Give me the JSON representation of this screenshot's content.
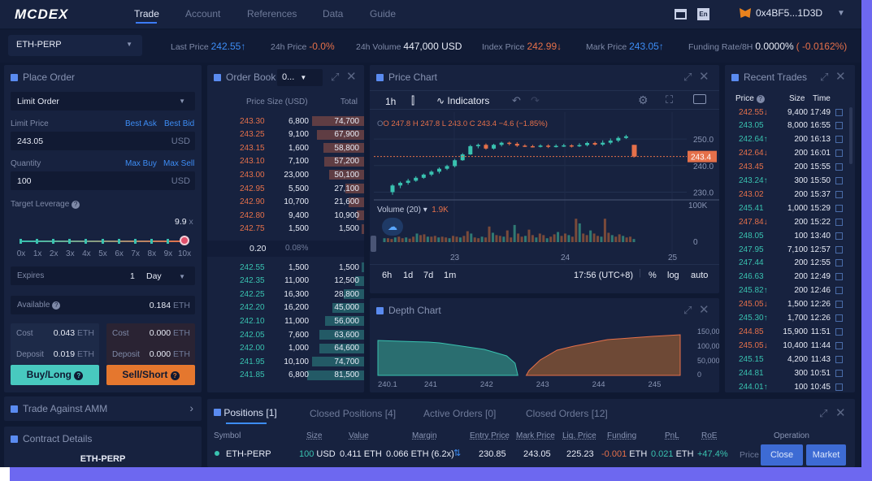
{
  "nav": {
    "logo": "MCDEX",
    "items": [
      "Trade",
      "Account",
      "References",
      "Data",
      "Guide"
    ],
    "wallet": "0x4BF5...1D3D",
    "lang": "En"
  },
  "market": {
    "pair": "ETH-PERP",
    "last_label": "Last Price",
    "last": "242.55↑",
    "h24_label": "24h Price",
    "h24": "-0.0%",
    "vol_label": "24h Volume",
    "vol": "447,000 USD",
    "index_label": "Index Price",
    "index": "242.99↓",
    "mark_label": "Mark Price",
    "mark": "243.05↑",
    "fund_label": "Funding Rate/8H",
    "fund": "0.0000%",
    "fund_alt": "( -0.0162%)"
  },
  "order": {
    "title": "Place Order",
    "type": "Limit Order",
    "lp_label": "Limit Price",
    "best_ask": "Best Ask",
    "best_bid": "Best Bid",
    "lp": "243.05",
    "usd": "USD",
    "qty_label": "Quantity",
    "max_buy": "Max Buy",
    "max_sell": "Max Sell",
    "qty": "100",
    "lev_label": "Target Leverage",
    "lev": "9.9",
    "x": "x",
    "lev_ticks": [
      "0x",
      "1x",
      "2x",
      "3x",
      "4x",
      "5x",
      "6x",
      "7x",
      "8x",
      "9x",
      "10x"
    ],
    "expires_label": "Expires",
    "expires_num": "1",
    "expires_unit": "Day",
    "avail_label": "Available",
    "avail": "0.184",
    "eth": "ETH",
    "cost_label": "Cost",
    "deposit_label": "Deposit",
    "buy_cost": "0.043",
    "buy_dep": "0.019",
    "sell_cost": "0.000",
    "sell_dep": "0.000",
    "buy_btn": "Buy/Long",
    "sell_btn": "Sell/Short",
    "amm": "Trade Against AMM",
    "contract": "Contract Details",
    "contract_sym": "ETH-PERP"
  },
  "book": {
    "title": "Order Book",
    "agg": "0...",
    "h_price": "Price",
    "h_size": "Size (USD)",
    "h_total": "Total",
    "asks": [
      [
        "243.30",
        "6,800",
        "74,700"
      ],
      [
        "243.25",
        "9,100",
        "67,900"
      ],
      [
        "243.15",
        "1,600",
        "58,800"
      ],
      [
        "243.10",
        "7,100",
        "57,200"
      ],
      [
        "243.00",
        "23,000",
        "50,100"
      ],
      [
        "242.95",
        "5,500",
        "27,100"
      ],
      [
        "242.90",
        "10,700",
        "21,600"
      ],
      [
        "242.80",
        "9,400",
        "10,900"
      ],
      [
        "242.75",
        "1,500",
        "1,500"
      ]
    ],
    "spread": "0.20",
    "spread_pct": "0.08%",
    "bids": [
      [
        "242.55",
        "1,500",
        "1,500"
      ],
      [
        "242.35",
        "11,000",
        "12,500"
      ],
      [
        "242.25",
        "16,300",
        "28,800"
      ],
      [
        "242.20",
        "16,200",
        "45,000"
      ],
      [
        "242.10",
        "11,000",
        "56,000"
      ],
      [
        "242.05",
        "7,600",
        "63,600"
      ],
      [
        "242.00",
        "1,000",
        "64,600"
      ],
      [
        "241.95",
        "10,100",
        "74,700"
      ],
      [
        "241.85",
        "6,800",
        "81,500"
      ]
    ]
  },
  "pchart": {
    "title": "Price Chart",
    "interval": "1h",
    "indicators": "Indicators",
    "ohlc_o": "O 247.8",
    "ohlc_h": "H 247.8",
    "ohlc_l": "L 243.0",
    "ohlc_c": "C 243.4",
    "ohlc_chg": "−4.6 (−1.85%)",
    "y": [
      "250.0",
      "240.0",
      "230.0"
    ],
    "cur": "243.4",
    "vol_label": "Volume (20)",
    "vol_val": "1.9K",
    "vol_y": "100K",
    "vol_y0": "0",
    "x": [
      "23",
      "24",
      "25"
    ],
    "ranges": [
      "6h",
      "1d",
      "7d",
      "1m"
    ],
    "time": "17:56 (UTC+8)",
    "pct": "%",
    "log": "log",
    "auto": "auto"
  },
  "depth": {
    "title": "Depth Chart",
    "y": [
      "150,00",
      "100,00",
      "50,000",
      "0"
    ],
    "x": [
      "240.1",
      "241",
      "242",
      "243",
      "244",
      "245"
    ]
  },
  "trades": {
    "title": "Recent Trades",
    "h_price": "Price",
    "h_size": "Size",
    "h_time": "Time",
    "rows": [
      [
        "242.55↓",
        "9,400",
        "17:49",
        "r"
      ],
      [
        "243.05",
        "8,000",
        "16:55",
        "g"
      ],
      [
        "242.64↑",
        "200",
        "16:13",
        "g"
      ],
      [
        "242.64↓",
        "200",
        "16:01",
        "r"
      ],
      [
        "243.45",
        "200",
        "15:55",
        "r"
      ],
      [
        "243.24↑",
        "300",
        "15:50",
        "g"
      ],
      [
        "243.02",
        "200",
        "15:37",
        "r"
      ],
      [
        "245.41",
        "1,000",
        "15:29",
        "g"
      ],
      [
        "247.84↓",
        "200",
        "15:22",
        "r"
      ],
      [
        "248.05",
        "100",
        "13:40",
        "g"
      ],
      [
        "247.95",
        "7,100",
        "12:57",
        "g"
      ],
      [
        "247.44",
        "200",
        "12:55",
        "g"
      ],
      [
        "246.63",
        "200",
        "12:49",
        "g"
      ],
      [
        "245.82↑",
        "200",
        "12:46",
        "g"
      ],
      [
        "245.05↓",
        "1,500",
        "12:26",
        "r"
      ],
      [
        "245.30↑",
        "1,700",
        "12:26",
        "g"
      ],
      [
        "244.85",
        "15,900",
        "11:51",
        "r"
      ],
      [
        "245.05↓",
        "10,400",
        "11:44",
        "r"
      ],
      [
        "245.15",
        "4,200",
        "11:43",
        "g"
      ],
      [
        "244.81",
        "300",
        "10:51",
        "g"
      ],
      [
        "244.01↑",
        "100",
        "10:45",
        "g"
      ]
    ]
  },
  "positions": {
    "tabs": [
      "Positions [1]",
      "Closed Positions [4]",
      "Active Orders [0]",
      "Closed Orders [12]"
    ],
    "cols": [
      "Symbol",
      "Size",
      "Value",
      "Margin",
      "Entry Price",
      "Mark Price",
      "Liq. Price",
      "Funding",
      "PnL",
      "RoE",
      "Operation"
    ],
    "row": {
      "symbol": "ETH-PERP",
      "size": "100",
      "size_unit": "USD",
      "value": "0.411 ETH",
      "margin": "0.066 ETH (6.2x)",
      "entry": "230.85",
      "mark": "243.05",
      "liq": "225.23",
      "funding": "-0.001",
      "funding_unit": "ETH",
      "pnl": "0.021",
      "pnl_unit": "ETH",
      "roe": "+47.4%",
      "op_price": "Price",
      "op_close": "Close",
      "op_market": "Market"
    }
  },
  "colors": {
    "bg": "#0f1932",
    "panel": "#17223f",
    "green": "#39c2b0",
    "red": "#e5704a",
    "blue": "#3d8df5",
    "buy": "#48c9bf",
    "sell": "#e5772e",
    "accent": "#6d68f0"
  },
  "chart_data": [
    {
      "type": "candlestick",
      "title": "",
      "y_axis": [
        "250.0",
        "240.0",
        "230.0"
      ],
      "x_ticks": [
        "23",
        "24",
        "25"
      ],
      "ylim": [
        228,
        254
      ],
      "last": 243.4,
      "candles": [
        [
          230,
          232.5,
          229,
          233
        ],
        [
          232.5,
          233.5,
          231.5,
          234
        ],
        [
          233.5,
          234.3,
          232.8,
          235
        ],
        [
          234.3,
          235.4,
          233.9,
          236
        ],
        [
          235.4,
          236.6,
          235,
          237
        ],
        [
          236.6,
          237.7,
          236,
          238.2
        ],
        [
          237.7,
          238.8,
          237,
          239.3
        ],
        [
          238.8,
          239.8,
          238.3,
          240.3
        ],
        [
          239.8,
          242,
          239.3,
          242.5
        ],
        [
          242,
          244.2,
          241.8,
          244.7
        ],
        [
          244.2,
          247.3,
          244,
          247.8
        ],
        [
          247.3,
          247.8,
          246.5,
          248.3
        ],
        [
          247.8,
          246.4,
          246,
          248.3
        ],
        [
          246.4,
          247.8,
          246,
          248.2
        ],
        [
          247.8,
          248.6,
          247.2,
          249
        ],
        [
          248.6,
          248.2,
          247.6,
          249
        ],
        [
          248.2,
          247.5,
          247,
          248.8
        ],
        [
          247.5,
          247.3,
          247,
          248
        ],
        [
          247.3,
          247.2,
          246.8,
          247.8
        ],
        [
          247.2,
          247.5,
          246.8,
          248
        ],
        [
          247.5,
          247.1,
          246.6,
          248
        ],
        [
          247.1,
          247.4,
          246.8,
          248
        ],
        [
          247.4,
          247.6,
          247,
          248.2
        ],
        [
          247.6,
          247.3,
          246.8,
          248
        ],
        [
          247.3,
          247.7,
          247,
          248.4
        ],
        [
          247.7,
          248.5,
          247.2,
          249
        ],
        [
          248.5,
          247.9,
          247.5,
          249
        ],
        [
          247.9,
          248.6,
          247.4,
          249.5
        ],
        [
          248.6,
          249.4,
          248,
          250.2
        ],
        [
          249.4,
          250.4,
          248.8,
          251
        ],
        [
          250.4,
          251,
          250,
          251.6
        ],
        [
          247.8,
          243.4,
          243,
          247.8
        ]
      ]
    },
    {
      "type": "bar",
      "title": "Volume (20)",
      "values": [
        10,
        10,
        8,
        12,
        14,
        10,
        12,
        9,
        14,
        22,
        18,
        20,
        14,
        14,
        16,
        12,
        14,
        12,
        10,
        16,
        14,
        12,
        16,
        28,
        22,
        12,
        10,
        14,
        12,
        40,
        24,
        18,
        16,
        14,
        30,
        12,
        44,
        22,
        14,
        16,
        32,
        18,
        12,
        22,
        18,
        10,
        14,
        20,
        26,
        16,
        22,
        18,
        14,
        60,
        48,
        22,
        18,
        30,
        22,
        16,
        14,
        60,
        24,
        18,
        14,
        20,
        16,
        12,
        14,
        8
      ],
      "ymax": 100
    },
    {
      "type": "area",
      "title": "Depth Chart",
      "x_ticks": [
        "240.1",
        "241",
        "242",
        "243",
        "244",
        "245"
      ],
      "bids": [
        [
          240.1,
          86
        ],
        [
          240.5,
          84
        ],
        [
          241,
          82
        ],
        [
          241.2,
          80
        ],
        [
          241.5,
          74
        ],
        [
          241.8,
          68
        ],
        [
          242,
          64
        ],
        [
          242.2,
          56
        ],
        [
          242.4,
          48
        ],
        [
          242.55,
          30
        ],
        [
          242.6,
          0
        ]
      ],
      "asks": [
        [
          242.75,
          0
        ],
        [
          242.8,
          12
        ],
        [
          243,
          38
        ],
        [
          243.3,
          62
        ],
        [
          243.6,
          72
        ],
        [
          243.9,
          80
        ],
        [
          244.2,
          88
        ],
        [
          244.6,
          92
        ],
        [
          245,
          96
        ],
        [
          245.5,
          100
        ]
      ],
      "ymax": 150
    }
  ]
}
